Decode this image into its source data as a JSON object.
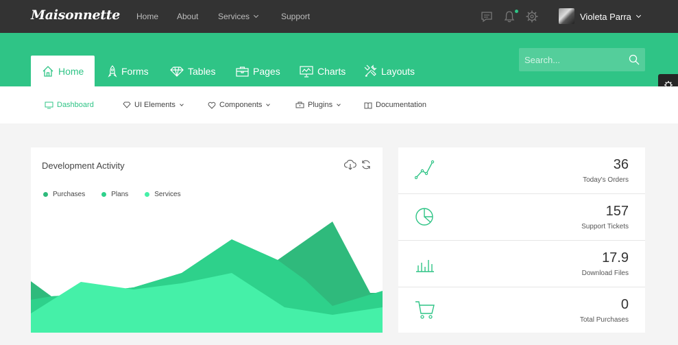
{
  "brand": {
    "logo": "Maisonnette"
  },
  "topnav": {
    "items": [
      "Home",
      "About",
      "Services",
      "Support"
    ]
  },
  "user": {
    "name": "Violeta Parra"
  },
  "maintabs": [
    "Home",
    "Forms",
    "Tables",
    "Pages",
    "Charts",
    "Layouts"
  ],
  "search": {
    "placeholder": "Search..."
  },
  "subnav": [
    "Dashboard",
    "UI Elements",
    "Components",
    "Plugins",
    "Documentation"
  ],
  "activity": {
    "title": "Development Activity",
    "legend": [
      {
        "label": "Purchases",
        "color": "#2fba7c"
      },
      {
        "label": "Plans",
        "color": "#2ed18b"
      },
      {
        "label": "Services",
        "color": "#45f0a8"
      }
    ]
  },
  "stats": [
    {
      "value": "36",
      "label": "Today's Orders",
      "icon": "trend-line-icon"
    },
    {
      "value": "157",
      "label": "Support Tickets",
      "icon": "pie-chart-icon"
    },
    {
      "value": "17.9",
      "label": "Download Files",
      "icon": "bar-chart-icon"
    },
    {
      "value": "0",
      "label": "Total Purchases",
      "icon": "cart-icon"
    }
  ],
  "colors": {
    "accent": "#2fc486",
    "topbar": "#333333"
  }
}
